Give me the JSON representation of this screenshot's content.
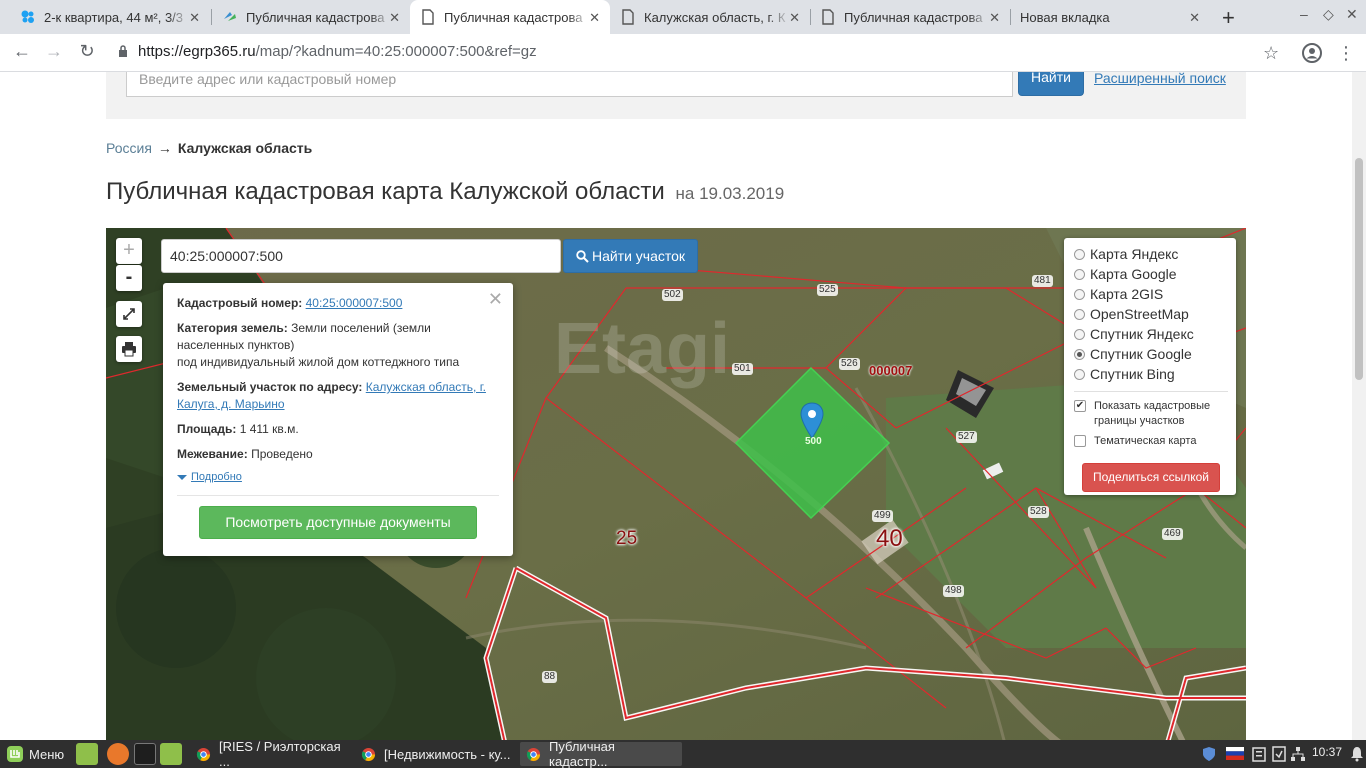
{
  "tabs": [
    {
      "title": "2-к квартира, 44 м², 3/3",
      "close": "✕"
    },
    {
      "title": "Публичная кадастрова",
      "close": "✕"
    },
    {
      "title": "Публичная кадастрова",
      "close": "✕"
    },
    {
      "title": "Калужская область, г. К",
      "close": "✕"
    },
    {
      "title": "Публичная кадастрова",
      "close": "✕"
    },
    {
      "title": "Новая вкладка",
      "close": "✕"
    }
  ],
  "browser": {
    "url_host": "https://egrp365.ru",
    "url_path": "/map/?kadnum=40:25:000007:500&ref=gz",
    "new_tab": "+",
    "win_minimize": "–",
    "win_maximize": "◇",
    "win_close": "✕",
    "back": "←",
    "forward": "→",
    "reload": "↻",
    "bookmark": "☆",
    "menu": "⋮"
  },
  "header": {
    "search_placeholder": "Введите адрес или кадастровый номер",
    "search_button": "Найти",
    "advanced_search": "Расширенный поиск"
  },
  "breadcrumb": {
    "root": "Россия",
    "arrow": "→",
    "current": "Калужская область"
  },
  "page": {
    "title": "Публичная кадастровая карта Калужской области",
    "date": "на 19.03.2019"
  },
  "map": {
    "zoom_in": "+",
    "zoom_out": "-",
    "cadnum_value": "40:25:000007:500",
    "find_button": "Найти участок",
    "marker_label": "500",
    "quarter_label": "000007",
    "big_labels": [
      "25",
      "40"
    ],
    "plot_labels": [
      "502",
      "525",
      "481",
      "501",
      "526",
      "527",
      "499",
      "528",
      "469",
      "498",
      "88"
    ],
    "popup": {
      "close": "✕",
      "cadnum_label": "Кадастровый номер:",
      "cadnum_value": "40:25:000007:500",
      "category_label": "Категория земель:",
      "category_value": "Земли поселений (земли населенных пунктов)",
      "category_use": "под индивидуальный жилой дом коттеджного типа",
      "address_label": "Земельный участок по адресу:",
      "address_value": "Калужская область, г. Калуга, д. Марьино",
      "area_label": "Площадь:",
      "area_value": "1 411 кв.м.",
      "survey_label": "Межевание:",
      "survey_value": "Проведено",
      "more_link": "Подробно",
      "docs_button": "Посмотреть доступные документы"
    },
    "layers": {
      "options": [
        {
          "label": "Карта Яндекс",
          "selected": false
        },
        {
          "label": "Карта Google",
          "selected": false
        },
        {
          "label": "Карта 2GIS",
          "selected": false
        },
        {
          "label": "OpenStreetMap",
          "selected": false
        },
        {
          "label": "Спутник Яндекс",
          "selected": false
        },
        {
          "label": "Спутник Google",
          "selected": true
        },
        {
          "label": "Спутник Bing",
          "selected": false
        }
      ],
      "show_borders_label": "Показать кадастровые границы участков",
      "show_borders_checked": true,
      "thematic_label": "Тематическая карта",
      "thematic_checked": false,
      "share_button": "Поделиться ссылкой"
    }
  },
  "taskbar": {
    "menu_label": "Меню",
    "windows": [
      {
        "title": "[RIES / Риэлторская ..."
      },
      {
        "title": "[Недвижимость - ку..."
      },
      {
        "title": "Публичная кадастр..."
      }
    ],
    "clock": "10:37"
  },
  "colors": {
    "primary_button": "#337ab7",
    "success_button": "#5cb85c",
    "danger_button": "#d9534f",
    "plot_highlight": "#3ec04a",
    "cadastral_border": "#e0282d"
  }
}
